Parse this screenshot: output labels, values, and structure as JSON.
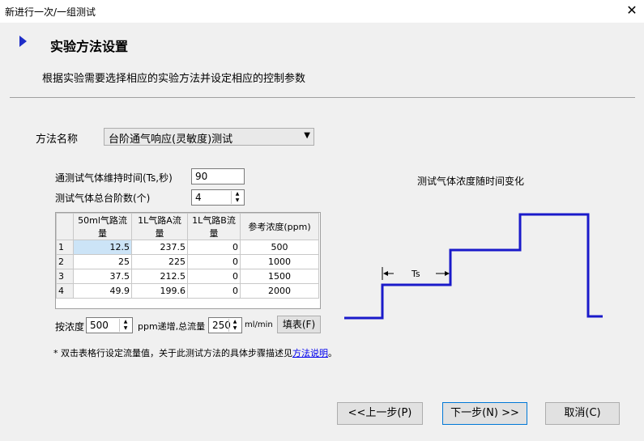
{
  "window": {
    "title": "新进行一次/一组测试"
  },
  "header": {
    "title": "实验方法设置",
    "subtitle": "根据实验需要选择相应的实验方法并设定相应的控制参数"
  },
  "method": {
    "label": "方法名称",
    "value": "台阶通气响应(灵敏度)测试"
  },
  "params": {
    "hold_label": "通测试气体维持时间(Ts,秒)",
    "hold_value": "90",
    "steps_label": "测试气体总台阶数(个)",
    "steps_value": "4"
  },
  "table": {
    "headers": [
      "",
      "50ml气路流量",
      "1L气路A流量",
      "1L气路B流量",
      "参考浓度(ppm)"
    ],
    "rows": [
      [
        "1",
        "12.5",
        "237.5",
        "0",
        "500"
      ],
      [
        "2",
        "25",
        "225",
        "0",
        "1000"
      ],
      [
        "3",
        "37.5",
        "212.5",
        "0",
        "1500"
      ],
      [
        "4",
        "49.9",
        "199.6",
        "0",
        "2000"
      ]
    ]
  },
  "fill": {
    "conc_label": "按浓度",
    "conc_value": "500",
    "ppm_label": "ppm递增,总流量",
    "flow_value": "250",
    "unit_label": "ml/min",
    "fill_button": "填表(F)"
  },
  "note": {
    "prefix": "* 双击表格行设定流量值，关于此测试方法的具体步骤描述见",
    "link": "方法说明",
    "suffix": "。"
  },
  "diagram": {
    "title": "测试气体浓度随时间变化",
    "ts_label": "Ts",
    "line_color": "#1a1aca"
  },
  "buttons": {
    "prev": "<<上一步(P)",
    "next": "下一步(N) >>",
    "cancel": "取消(C)"
  }
}
